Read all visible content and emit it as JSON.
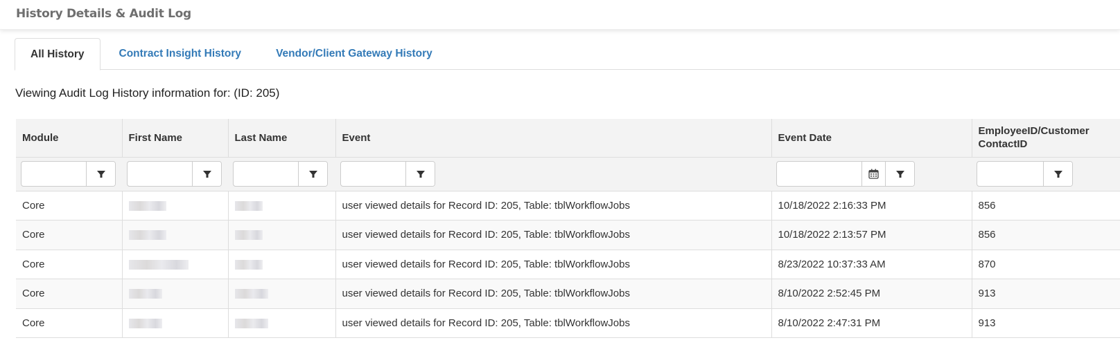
{
  "header": {
    "title": "History Details & Audit Log"
  },
  "tabs": [
    {
      "label": "All History",
      "active": true
    },
    {
      "label": "Contract Insight History",
      "active": false
    },
    {
      "label": "Vendor/Client Gateway History",
      "active": false
    }
  ],
  "info": {
    "text": "Viewing Audit Log History information for: (ID: 205)"
  },
  "grid": {
    "columns": [
      {
        "label": "Module"
      },
      {
        "label": "First Name"
      },
      {
        "label": "Last Name"
      },
      {
        "label": "Event"
      },
      {
        "label": "Event Date"
      },
      {
        "label": "EmployeeID/Customer ContactID"
      }
    ],
    "filters": {
      "module": "",
      "first_name": "",
      "last_name": "",
      "event": "",
      "event_date": "",
      "employee_id": ""
    },
    "icons": {
      "filter": "filter-icon",
      "calendar": "calendar-icon"
    },
    "rows": [
      {
        "module": "Core",
        "first_name": "[redacted]",
        "last_name": "[redacted]",
        "event": "user viewed details for Record ID: 205, Table: tblWorkflowJobs",
        "event_date": "10/18/2022 2:16:33 PM",
        "employee_id": "856"
      },
      {
        "module": "Core",
        "first_name": "[redacted]",
        "last_name": "[redacted]",
        "event": "user viewed details for Record ID: 205, Table: tblWorkflowJobs",
        "event_date": "10/18/2022 2:13:57 PM",
        "employee_id": "856"
      },
      {
        "module": "Core",
        "first_name": "[redacted]",
        "last_name": "[redacted]",
        "event": "user viewed details for Record ID: 205, Table: tblWorkflowJobs",
        "event_date": "8/23/2022 10:37:33 AM",
        "employee_id": "870"
      },
      {
        "module": "Core",
        "first_name": "[redacted]",
        "last_name": "[redacted]",
        "event": "user viewed details for Record ID: 205, Table: tblWorkflowJobs",
        "event_date": "8/10/2022 2:52:45 PM",
        "employee_id": "913"
      },
      {
        "module": "Core",
        "first_name": "[redacted]",
        "last_name": "[redacted]",
        "event": "user viewed details for Record ID: 205, Table: tblWorkflowJobs",
        "event_date": "8/10/2022 2:47:31 PM",
        "employee_id": "913"
      }
    ]
  }
}
